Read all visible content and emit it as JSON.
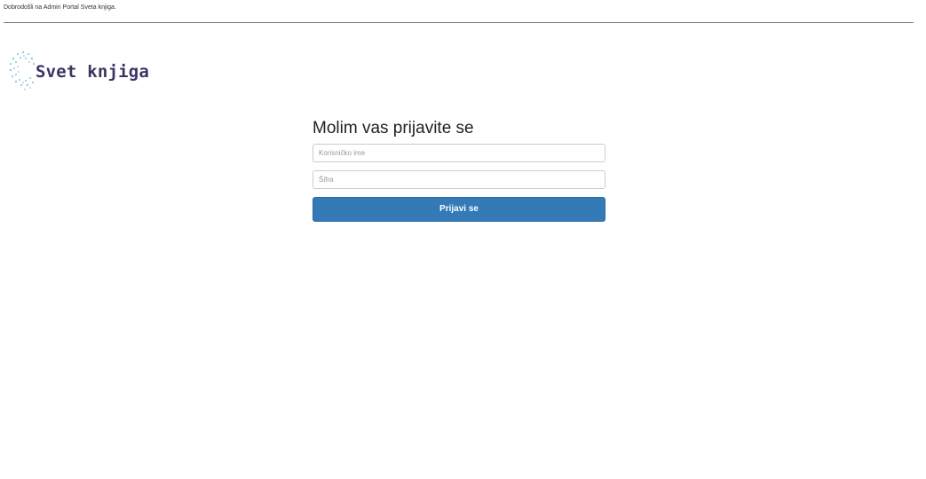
{
  "header": {
    "welcome_text": "Dobrodošli na Admin Portal Sveta knjiga."
  },
  "logo": {
    "text": "Svet knjiga",
    "icon": "dotted-circle-logo-icon",
    "text_color": "#3b3562",
    "dot_colors": [
      "#7fd3e8",
      "#5fb8d9",
      "#a89fd9"
    ]
  },
  "login": {
    "heading": "Molim vas prijavite se",
    "username_placeholder": "Korisničko ime",
    "password_placeholder": "Šifra",
    "submit_label": "Prijavi se",
    "button_color": "#337ab7"
  }
}
